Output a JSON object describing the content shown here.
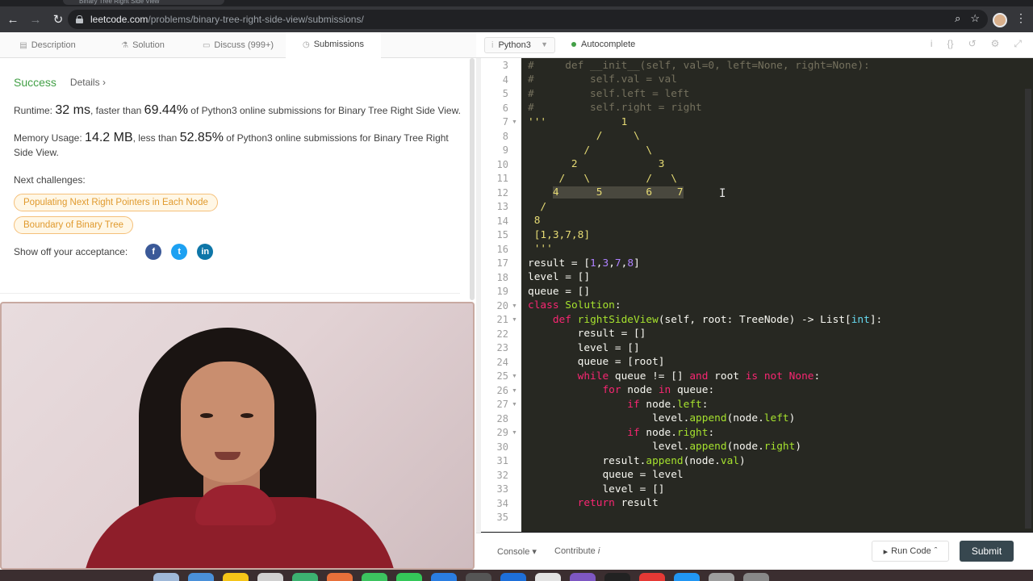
{
  "browser": {
    "tab_title": "Binary Tree Right Side View",
    "url_host": "leetcode.com",
    "url_path": "/problems/binary-tree-right-side-view/submissions/"
  },
  "left_tabs": [
    {
      "label": "Description",
      "icon": "document-icon"
    },
    {
      "label": "Solution",
      "icon": "flask-icon"
    },
    {
      "label": "Discuss (999+)",
      "icon": "chat-icon"
    },
    {
      "label": "Submissions",
      "icon": "clock-icon"
    }
  ],
  "submission": {
    "status": "Success",
    "details_label": "Details",
    "runtime_label": "Runtime:",
    "runtime_value": "32 ms",
    "runtime_mid": ", faster than",
    "runtime_pct": "69.44%",
    "runtime_tail": "of Python3 online submissions for Binary Tree Right Side View.",
    "memory_label": "Memory Usage:",
    "memory_value": "14.2 MB",
    "memory_mid": ", less than",
    "memory_pct": "52.85%",
    "memory_tail": "of Python3 online submissions for Binary Tree Right Side View.",
    "next_label": "Next challenges:",
    "challenges": [
      "Populating Next Right Pointers in Each Node",
      "Boundary of Binary Tree"
    ],
    "share_label": "Show off your acceptance:",
    "social": [
      {
        "name": "facebook",
        "glyph": "f",
        "color": "#3b5998"
      },
      {
        "name": "twitter",
        "glyph": "t",
        "color": "#1da1f2"
      },
      {
        "name": "linkedin",
        "glyph": "in",
        "color": "#0e76a8"
      }
    ]
  },
  "editor": {
    "language": "Python3",
    "autocomplete": "Autocomplete",
    "lines": [
      {
        "n": "3",
        "fold": false,
        "html": "<span class=\"c-com\">#     def __init__(self, val=0, left=None, right=None):</span>"
      },
      {
        "n": "4",
        "fold": false,
        "html": "<span class=\"c-com\">#         self.val = val</span>"
      },
      {
        "n": "5",
        "fold": false,
        "html": "<span class=\"c-com\">#         self.left = left</span>"
      },
      {
        "n": "6",
        "fold": false,
        "html": "<span class=\"c-com\">#         self.right = right</span>"
      },
      {
        "n": "7",
        "fold": true,
        "html": "<span class=\"c-str\">'''            1</span>"
      },
      {
        "n": "8",
        "fold": false,
        "html": "<span class=\"c-str\">           /     \\</span>"
      },
      {
        "n": "9",
        "fold": false,
        "html": "<span class=\"c-str\">         /         \\</span>"
      },
      {
        "n": "10",
        "fold": false,
        "html": "<span class=\"c-str\">       2             3</span>"
      },
      {
        "n": "11",
        "fold": false,
        "html": "<span class=\"c-str\">     /   \\         /   \\</span>"
      },
      {
        "n": "12",
        "fold": false,
        "html": "<span class=\"c-str\">    <span class=\"hl\">4      5       6    7</span></span>"
      },
      {
        "n": "13",
        "fold": false,
        "html": "<span class=\"c-str\">  /</span>"
      },
      {
        "n": "14",
        "fold": false,
        "html": "<span class=\"c-str\"> 8</span>"
      },
      {
        "n": "15",
        "fold": false,
        "html": "<span class=\"c-str\"> [1,3,7,8]</span>"
      },
      {
        "n": "16",
        "fold": false,
        "html": "<span class=\"c-str\"> '''</span>"
      },
      {
        "n": "17",
        "fold": false,
        "html": "result = [<span class=\"c-num\">1</span>,<span class=\"c-num\">3</span>,<span class=\"c-num\">7</span>,<span class=\"c-num\">8</span>]"
      },
      {
        "n": "18",
        "fold": false,
        "html": "level = []"
      },
      {
        "n": "19",
        "fold": false,
        "html": "queue = []"
      },
      {
        "n": "20",
        "fold": true,
        "html": "<span class=\"c-kw\">class</span> <span class=\"c-fn\">Solution</span>:"
      },
      {
        "n": "21",
        "fold": true,
        "html": "    <span class=\"c-kw\">def</span> <span class=\"c-fn\">rightSideView</span>(self, root: TreeNode) -> List[<span class=\"c-typ\">int</span>]:"
      },
      {
        "n": "22",
        "fold": false,
        "html": "        result = []"
      },
      {
        "n": "23",
        "fold": false,
        "html": "        level = []"
      },
      {
        "n": "24",
        "fold": false,
        "html": "        queue = [root]"
      },
      {
        "n": "25",
        "fold": true,
        "html": "        <span class=\"c-kw\">while</span> queue != [] <span class=\"c-kw\">and</span> root <span class=\"c-kw\">is not</span> <span class=\"c-kw\">None</span>:"
      },
      {
        "n": "26",
        "fold": true,
        "html": "            <span class=\"c-kw\">for</span> node <span class=\"c-kw\">in</span> queue:"
      },
      {
        "n": "27",
        "fold": true,
        "html": "                <span class=\"c-kw\">if</span> node.<span class=\"c-fn\">left</span>:"
      },
      {
        "n": "28",
        "fold": false,
        "html": "                    level.<span class=\"c-fn\">append</span>(node.<span class=\"c-fn\">left</span>)"
      },
      {
        "n": "29",
        "fold": true,
        "html": "                <span class=\"c-kw\">if</span> node.<span class=\"c-fn\">right</span>:"
      },
      {
        "n": "30",
        "fold": false,
        "html": "                    level.<span class=\"c-fn\">append</span>(node.<span class=\"c-fn\">right</span>)"
      },
      {
        "n": "31",
        "fold": false,
        "html": "            result.<span class=\"c-fn\">append</span>(node.<span class=\"c-fn\">val</span>)"
      },
      {
        "n": "32",
        "fold": false,
        "html": "            queue = level"
      },
      {
        "n": "33",
        "fold": false,
        "html": "            level = []"
      },
      {
        "n": "34",
        "fold": false,
        "html": "        <span class=\"c-kw\">return</span> result"
      },
      {
        "n": "35",
        "fold": false,
        "html": ""
      }
    ]
  },
  "footer": {
    "console": "Console",
    "contribute": "Contribute",
    "run_code": "Run Code",
    "submit": "Submit"
  },
  "dock_colors": [
    "#9fb8d8",
    "#4a90d9",
    "#f5c518",
    "#d0d0d0",
    "#3cb371",
    "#e8703a",
    "#3cc35f",
    "#34c759",
    "#2a7de1",
    "#555555",
    "#1e6fd9",
    "#e2e2e2",
    "#7e57c2",
    "#222222",
    "#e53935",
    "#2196f3",
    "#9e9e9e",
    "#888888"
  ]
}
